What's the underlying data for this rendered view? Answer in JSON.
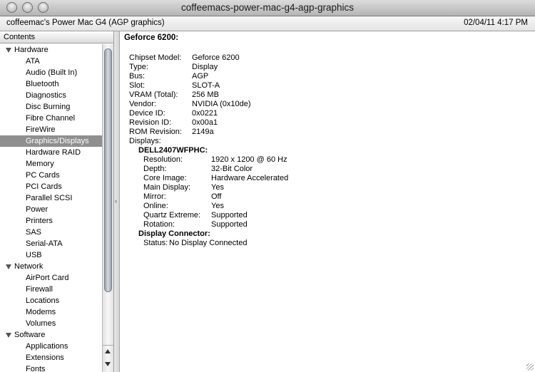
{
  "window": {
    "title": "coffeemacs-power-mac-g4-agp-graphics"
  },
  "infobar": {
    "machine": "coffeemac's Power Mac G4 (AGP graphics)",
    "datetime": "02/04/11 4:17 PM"
  },
  "sidebar": {
    "header": "Contents",
    "rows": [
      {
        "label": "Hardware",
        "type": "group"
      },
      {
        "label": "ATA",
        "type": "item"
      },
      {
        "label": "Audio (Built In)",
        "type": "item"
      },
      {
        "label": "Bluetooth",
        "type": "item"
      },
      {
        "label": "Diagnostics",
        "type": "item"
      },
      {
        "label": "Disc Burning",
        "type": "item"
      },
      {
        "label": "Fibre Channel",
        "type": "item"
      },
      {
        "label": "FireWire",
        "type": "item"
      },
      {
        "label": "Graphics/Displays",
        "type": "item",
        "selected": true
      },
      {
        "label": "Hardware RAID",
        "type": "item"
      },
      {
        "label": "Memory",
        "type": "item"
      },
      {
        "label": "PC Cards",
        "type": "item"
      },
      {
        "label": "PCI Cards",
        "type": "item"
      },
      {
        "label": "Parallel SCSI",
        "type": "item"
      },
      {
        "label": "Power",
        "type": "item"
      },
      {
        "label": "Printers",
        "type": "item"
      },
      {
        "label": "SAS",
        "type": "item"
      },
      {
        "label": "Serial-ATA",
        "type": "item"
      },
      {
        "label": "USB",
        "type": "item"
      },
      {
        "label": "Network",
        "type": "group"
      },
      {
        "label": "AirPort Card",
        "type": "item"
      },
      {
        "label": "Firewall",
        "type": "item"
      },
      {
        "label": "Locations",
        "type": "item"
      },
      {
        "label": "Modems",
        "type": "item"
      },
      {
        "label": "Volumes",
        "type": "item"
      },
      {
        "label": "Software",
        "type": "group"
      },
      {
        "label": "Applications",
        "type": "item"
      },
      {
        "label": "Extensions",
        "type": "item"
      },
      {
        "label": "Fonts",
        "type": "item"
      }
    ]
  },
  "detail": {
    "heading": "Geforce 6200:",
    "fields": [
      {
        "key": "Chipset Model:",
        "value": "Geforce 6200"
      },
      {
        "key": "Type:",
        "value": "Display"
      },
      {
        "key": "Bus:",
        "value": "AGP"
      },
      {
        "key": "Slot:",
        "value": "SLOT-A"
      },
      {
        "key": "VRAM (Total):",
        "value": "256 MB"
      },
      {
        "key": "Vendor:",
        "value": "NVIDIA (0x10de)"
      },
      {
        "key": "Device ID:",
        "value": "0x0221"
      },
      {
        "key": "Revision ID:",
        "value": "0x00a1"
      },
      {
        "key": "ROM Revision:",
        "value": "2149a"
      }
    ],
    "displays_label": "Displays:",
    "display_name": "DELL2407WFPHC:",
    "display_fields": [
      {
        "key": "Resolution:",
        "value": "1920 x 1200 @ 60 Hz"
      },
      {
        "key": "Depth:",
        "value": "32-Bit Color"
      },
      {
        "key": "Core Image:",
        "value": "Hardware Accelerated"
      },
      {
        "key": "Main Display:",
        "value": "Yes"
      },
      {
        "key": "Mirror:",
        "value": "Off"
      },
      {
        "key": "Online:",
        "value": "Yes"
      },
      {
        "key": "Quartz Extreme:",
        "value": "Supported"
      },
      {
        "key": "Rotation:",
        "value": "Supported"
      }
    ],
    "connector_name": "Display Connector:",
    "connector_status_key": "Status:",
    "connector_status_value": "No Display Connected"
  }
}
